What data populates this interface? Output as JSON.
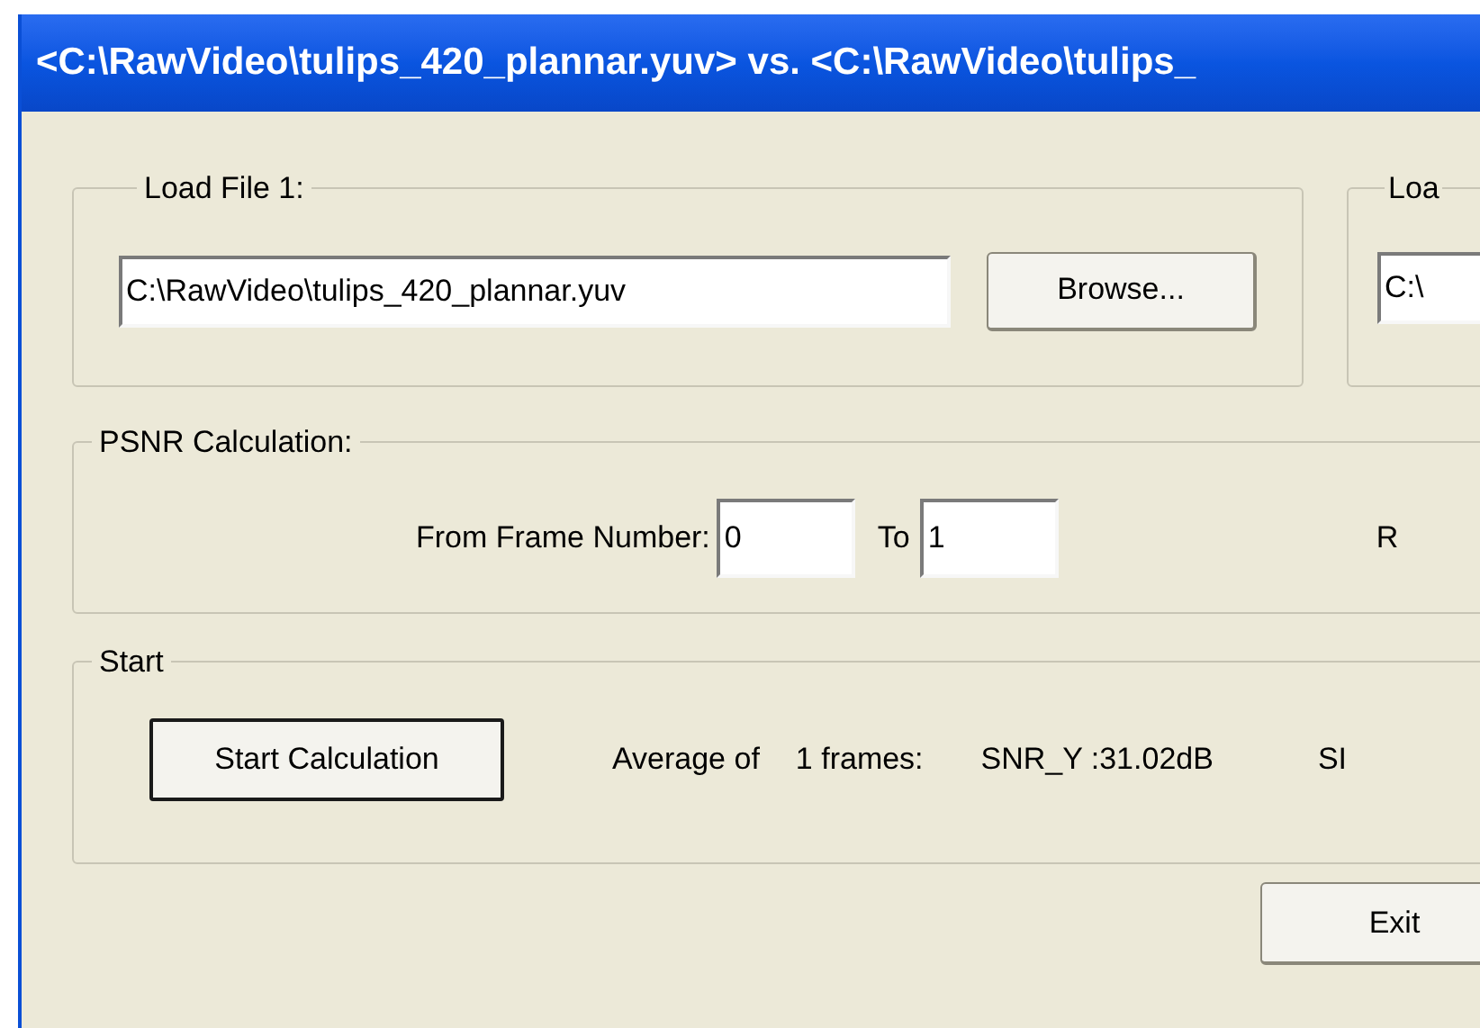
{
  "window": {
    "title": "<C:\\RawVideo\\tulips_420_plannar.yuv> vs. <C:\\RawVideo\\tulips_"
  },
  "load_file_1": {
    "label": "Load File 1:",
    "path": "C:\\RawVideo\\tulips_420_plannar.yuv",
    "browse_button": "Browse..."
  },
  "load_file_2": {
    "label": "Loa",
    "path": "C:\\"
  },
  "psnr_calculation": {
    "label": "PSNR Calculation:",
    "from_label": "From Frame Number:",
    "from_value": "0",
    "to_label": "To",
    "to_value": "1",
    "column_3": "R"
  },
  "start": {
    "label": "Start",
    "button": "Start Calculation",
    "average_label": "Average of",
    "frames": "1 frames:",
    "snr_y": "SNR_Y :31.02dB",
    "column_4": "SI"
  },
  "buttons": [
    "Exit"
  ]
}
